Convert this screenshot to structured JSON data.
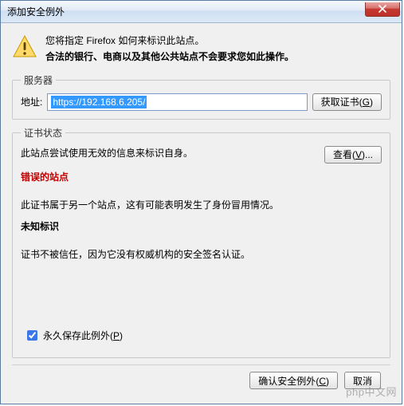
{
  "window": {
    "title": "添加安全例外"
  },
  "intro": {
    "line1": "您将指定 Firefox 如何来标识此站点。",
    "line2": "合法的银行、电商以及其他公共站点不会要求您如此操作。"
  },
  "server": {
    "legend": "服务器",
    "addr_label": "地址:",
    "addr_value": "https://192.168.6.205/",
    "get_cert_label": "获取证书",
    "get_cert_key": "G"
  },
  "status": {
    "legend": "证书状态",
    "desc": "此站点尝试使用无效的信息来标识自身。",
    "view_label": "查看",
    "view_key": "V",
    "wrong_site_title": "错误的站点",
    "wrong_site_desc": "此证书属于另一个站点，这有可能表明发生了身份冒用情况。",
    "unknown_title": "未知标识",
    "unknown_desc": "证书不被信任，因为它没有权威机构的安全签名认证。"
  },
  "save": {
    "label": "永久保存此例外",
    "key": "P",
    "checked": true
  },
  "buttons": {
    "confirm_label": "确认安全例外",
    "confirm_key": "C",
    "cancel_label": "取消"
  },
  "watermark": "php中文网"
}
